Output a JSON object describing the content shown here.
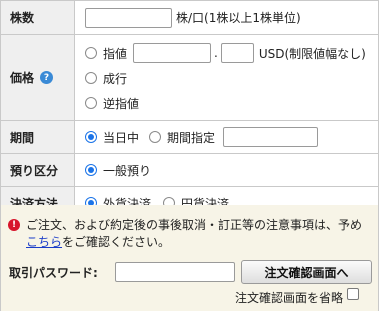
{
  "quantity": {
    "label": "株数",
    "value": "",
    "unit_note": "株/口(1株以上1株単位)"
  },
  "price": {
    "label": "価格",
    "help_icon": "question-icon",
    "options": [
      {
        "label": "指値",
        "selected": false
      },
      {
        "label": "成行",
        "selected": false
      },
      {
        "label": "逆指値",
        "selected": false
      }
    ],
    "limit_int_value": "",
    "decimal_point": ".",
    "limit_dec_value": "",
    "currency_note": "USD(制限値幅なし)"
  },
  "term": {
    "label": "期間",
    "options": [
      {
        "label": "当日中",
        "selected": true
      },
      {
        "label": "期間指定",
        "selected": false
      }
    ],
    "date_value": ""
  },
  "deposit": {
    "label": "預り区分",
    "options": [
      {
        "label": "一般預り",
        "selected": true
      }
    ]
  },
  "settlement": {
    "label": "決済方法",
    "options": [
      {
        "label": "外貨決済",
        "selected": true
      },
      {
        "label": "円貨決済",
        "selected": false
      }
    ]
  },
  "notice": {
    "icon": "exclamation-icon",
    "text_before": "ご注文、および約定後の事後取消・訂正等の注意事項は、予め",
    "link": "こちら",
    "text_after": "をご確認ください。"
  },
  "password": {
    "label": "取引パスワード:",
    "value": ""
  },
  "confirm_button": "注文確認画面へ",
  "skip_confirm": {
    "label": "注文確認画面を省略",
    "checked": false
  },
  "colors": {
    "label_bg": "#efefef",
    "border": "#c9c9c9",
    "notice_bg": "#f7f4e7",
    "radio_accent": "#1a73e8",
    "link": "#1a3cc8",
    "warn": "#d7142b"
  }
}
